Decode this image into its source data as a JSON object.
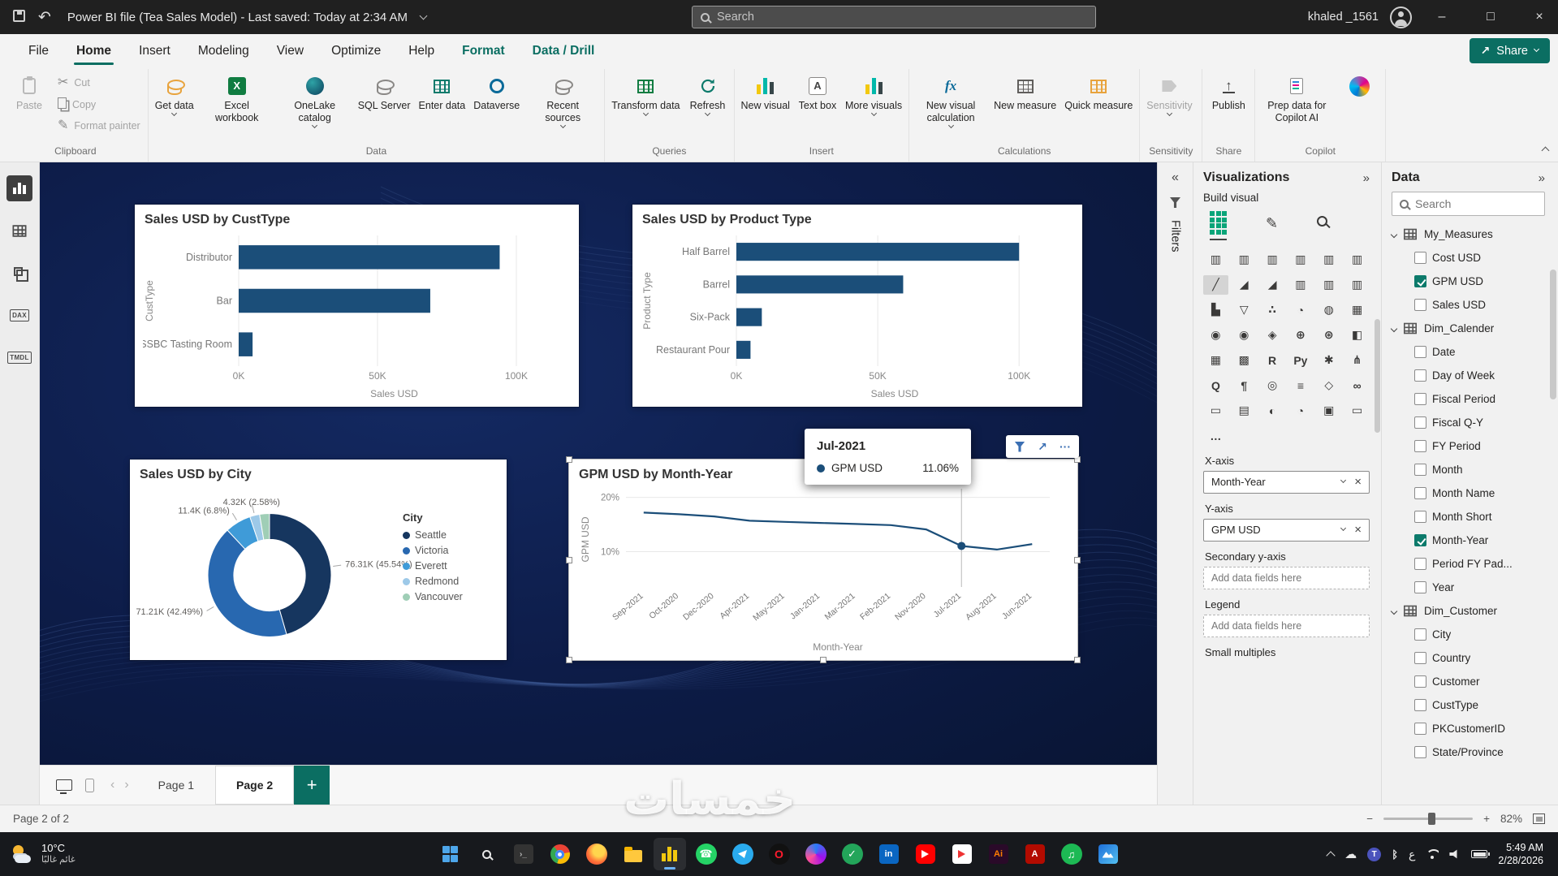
{
  "theme": {
    "accent_teal": "#0b6e62",
    "checkbox_teal": "#0c7a6b",
    "canvas_navy": "#0d1c48",
    "bar_blue": "#1b4e79"
  },
  "titlebar": {
    "title": "Power BI file (Tea Sales Model) - Last saved: Today at 2:34 AM",
    "search_placeholder": "Search",
    "user": "khaled _1561"
  },
  "menubar": {
    "tabs": [
      {
        "label": "File",
        "active": false,
        "contextual": false
      },
      {
        "label": "Home",
        "active": true,
        "contextual": false
      },
      {
        "label": "Insert",
        "active": false,
        "contextual": false
      },
      {
        "label": "Modeling",
        "active": false,
        "contextual": false
      },
      {
        "label": "View",
        "active": false,
        "contextual": false
      },
      {
        "label": "Optimize",
        "active": false,
        "contextual": false
      },
      {
        "label": "Help",
        "active": false,
        "contextual": false
      },
      {
        "label": "Format",
        "active": false,
        "contextual": true
      },
      {
        "label": "Data / Drill",
        "active": false,
        "contextual": true
      }
    ],
    "share_label": "Share"
  },
  "ribbon": {
    "groups": [
      {
        "label": "Clipboard",
        "items": [
          {
            "type": "big",
            "label": "Paste",
            "icon": "paste",
            "disabled": true
          },
          {
            "type": "col",
            "buttons": [
              {
                "label": "Cut",
                "icon": "cut",
                "disabled": true
              },
              {
                "label": "Copy",
                "icon": "copy",
                "disabled": true
              },
              {
                "label": "Format painter",
                "icon": "format-painter",
                "disabled": true
              }
            ]
          }
        ]
      },
      {
        "label": "Data",
        "items": [
          {
            "type": "big",
            "label": "Get data",
            "icon": "get-data",
            "chevron": true
          },
          {
            "type": "big",
            "label": "Excel workbook",
            "icon": "excel"
          },
          {
            "type": "big",
            "label": "OneLake catalog",
            "icon": "onelake",
            "chevron": true
          },
          {
            "type": "big",
            "label": "SQL Server",
            "icon": "sql-server"
          },
          {
            "type": "big",
            "label": "Enter data",
            "icon": "enter-data"
          },
          {
            "type": "big",
            "label": "Dataverse",
            "icon": "dataverse"
          },
          {
            "type": "big",
            "label": "Recent sources",
            "icon": "recent-sources",
            "chevron": true
          }
        ]
      },
      {
        "label": "Queries",
        "items": [
          {
            "type": "big",
            "label": "Transform data",
            "icon": "transform-data",
            "chevron": true
          },
          {
            "type": "big",
            "label": "Refresh",
            "icon": "refresh",
            "chevron": true
          }
        ]
      },
      {
        "label": "Insert",
        "items": [
          {
            "type": "big",
            "label": "New visual",
            "icon": "new-visual"
          },
          {
            "type": "big",
            "label": "Text box",
            "icon": "text-box"
          },
          {
            "type": "big",
            "label": "More visuals",
            "icon": "more-visuals",
            "chevron": true
          }
        ]
      },
      {
        "label": "Calculations",
        "items": [
          {
            "type": "big",
            "label": "New visual calculation",
            "icon": "new-visual-calculation",
            "chevron": true
          },
          {
            "type": "big",
            "label": "New measure",
            "icon": "new-measure"
          },
          {
            "type": "big",
            "label": "Quick measure",
            "icon": "quick-measure"
          }
        ]
      },
      {
        "label": "Sensitivity",
        "items": [
          {
            "type": "big",
            "label": "Sensitivity",
            "icon": "sensitivity",
            "chevron": true,
            "disabled": true
          }
        ]
      },
      {
        "label": "Share",
        "items": [
          {
            "type": "big",
            "label": "Publish",
            "icon": "publish"
          }
        ]
      },
      {
        "label": "Copilot",
        "items": [
          {
            "type": "big",
            "label": "Prep data for Copilot AI",
            "icon": "prep-copilot"
          },
          {
            "type": "big",
            "label": "",
            "icon": "copilot"
          }
        ]
      }
    ]
  },
  "leftrail": [
    "report-view",
    "table-view",
    "model-view",
    "dax-query-view",
    "tmdl-view"
  ],
  "chart_data": [
    {
      "type": "bar",
      "orientation": "horizontal",
      "title": "Sales USD by CustType",
      "categories": [
        "Distributor",
        "Bar",
        "SSBC Tasting Room"
      ],
      "values": [
        94000,
        69000,
        5000
      ],
      "xticks": [
        "0K",
        "50K",
        "100K"
      ],
      "xtick_values": [
        0,
        50000,
        100000
      ],
      "xmax": 112000,
      "xlabel": "Sales USD",
      "ylabel": "CustType",
      "bar_color": "#1b4e79",
      "grid": true
    },
    {
      "type": "bar",
      "orientation": "horizontal",
      "title": "Sales USD by Product Type",
      "categories": [
        "Half Barrel",
        "Barrel",
        "Six-Pack",
        "Restaurant Pour"
      ],
      "values": [
        100000,
        59000,
        9000,
        5000
      ],
      "xticks": [
        "0K",
        "50K",
        "100K"
      ],
      "xtick_values": [
        0,
        50000,
        100000
      ],
      "xmax": 112000,
      "xlabel": "Sales USD",
      "ylabel": "Product Type",
      "bar_color": "#1b4e79",
      "grid": true
    },
    {
      "type": "donut",
      "title": "Sales USD by City",
      "legend_title": "City",
      "legend_position": "right",
      "slices": [
        {
          "label": "Seattle",
          "value_k": 76.31,
          "pct": 45.54,
          "color": "#16365f",
          "data_label": "76.31K (45.54%)"
        },
        {
          "label": "Victoria",
          "value_k": 71.21,
          "pct": 42.49,
          "color": "#2868b0",
          "data_label": "71.21K (42.49%)"
        },
        {
          "label": "Everett",
          "value_k": 11.4,
          "pct": 6.8,
          "color": "#3f9bd8",
          "data_label": "11.4K (6.8%)"
        },
        {
          "label": "Redmond",
          "value_k": 4.32,
          "pct": 2.58,
          "color": "#9dc9e8",
          "data_label": "4.32K (2.58%)"
        },
        {
          "label": "Vancouver",
          "value_k": 4.34,
          "pct": 2.59,
          "color": "#9fceb6",
          "data_label": ""
        }
      ]
    },
    {
      "type": "line",
      "title": "GPM USD by Month-Year",
      "x": [
        "Sep-2021",
        "Oct-2020",
        "Dec-2020",
        "Apr-2021",
        "May-2021",
        "Jan-2021",
        "Mar-2021",
        "Feb-2021",
        "Nov-2020",
        "Jul-2021",
        "Aug-2021",
        "Jun-2021"
      ],
      "values": [
        17.2,
        16.9,
        16.5,
        15.7,
        15.5,
        15.3,
        15.1,
        14.9,
        14.1,
        11.06,
        10.4,
        11.4
      ],
      "ylim": [
        3.5,
        21
      ],
      "yticks": [
        "10%",
        "20%"
      ],
      "ytick_values": [
        10,
        20
      ],
      "xlabel": "Month-Year",
      "ylabel": "GPM USD",
      "line_color": "#1b4e79",
      "highlight_index": 9,
      "grid": true
    }
  ],
  "tooltip": {
    "title": "Jul-2021",
    "series": "GPM USD",
    "value": "11.06%",
    "dot_color": "#1b4e79"
  },
  "visual_header_icons": [
    "filter-icon",
    "focus-mode-icon",
    "more-options-icon"
  ],
  "filters_pane": {
    "label": "Filters"
  },
  "viz_panel": {
    "title": "Visualizations",
    "section": "Build visual",
    "subtabs": [
      "build-visual",
      "format-visual",
      "analytics"
    ],
    "visual_icons": [
      "stacked-bar-chart",
      "stacked-column-chart",
      "clustered-bar-chart",
      "clustered-column-chart",
      "100-stacked-bar-chart",
      "100-stacked-column-chart",
      "line-chart",
      "area-chart",
      "stacked-area-chart",
      "line-and-stacked-column-chart",
      "line-and-clustered-column-chart",
      "ribbon-chart",
      "waterfall-chart",
      "funnel-chart",
      "scatter-chart",
      "pie-chart",
      "donut-chart",
      "treemap",
      "map",
      "filled-map",
      "shape-map",
      "azure-map",
      "arcgis-map",
      "slicer",
      "table",
      "matrix",
      "r-script-visual",
      "python-visual",
      "key-influencers",
      "decomposition-tree",
      "qa-visual",
      "smart-narrative",
      "metrics",
      "paginated-report",
      "power-apps",
      "power-automate",
      "card",
      "multi-row-card",
      "kpi",
      "gauge",
      "button-slicer",
      "text-slicer",
      "more-options"
    ],
    "selected_visual": "line-chart",
    "field_wells": [
      {
        "label": "X-axis",
        "type": "pill",
        "value": "Month-Year"
      },
      {
        "label": "Y-axis",
        "type": "pill",
        "value": "GPM USD"
      },
      {
        "label": "Secondary y-axis",
        "type": "placeholder",
        "value": "Add data fields here"
      },
      {
        "label": "Legend",
        "type": "placeholder",
        "value": "Add data fields here"
      },
      {
        "label": "Small multiples",
        "type": "label-only"
      }
    ]
  },
  "data_panel": {
    "title": "Data",
    "search_placeholder": "Search",
    "tables": [
      {
        "name": "My_Measures",
        "icon": "measures-table-icon",
        "fields": [
          {
            "name": "Cost USD",
            "checked": false
          },
          {
            "name": "GPM USD",
            "checked": true
          },
          {
            "name": "Sales USD",
            "checked": false
          }
        ]
      },
      {
        "name": "Dim_Calender",
        "icon": "table-icon",
        "fields": [
          {
            "name": "Date",
            "checked": false,
            "icon": "date-field-icon"
          },
          {
            "name": "Day of Week",
            "checked": false
          },
          {
            "name": "Fiscal Period",
            "checked": false
          },
          {
            "name": "Fiscal Q-Y",
            "checked": false
          },
          {
            "name": "FY Period",
            "checked": false
          },
          {
            "name": "Month",
            "checked": false
          },
          {
            "name": "Month Name",
            "checked": false
          },
          {
            "name": "Month Short",
            "checked": false
          },
          {
            "name": "Month-Year",
            "checked": true
          },
          {
            "name": "Period FY Pad...",
            "checked": false
          },
          {
            "name": "Year",
            "checked": false
          }
        ]
      },
      {
        "name": "Dim_Customer",
        "icon": "table-icon",
        "fields": [
          {
            "name": "City",
            "checked": false
          },
          {
            "name": "Country",
            "checked": false
          },
          {
            "name": "Customer",
            "checked": false
          },
          {
            "name": "CustType",
            "checked": false
          },
          {
            "name": "PKCustomerID",
            "checked": false
          },
          {
            "name": "State/Province",
            "checked": false
          }
        ]
      }
    ]
  },
  "pagestrip": {
    "pages": [
      {
        "label": "Page 1",
        "active": false
      },
      {
        "label": "Page 2",
        "active": true
      }
    ]
  },
  "status": {
    "left": "Page 2 of 2",
    "zoom": "82%"
  },
  "taskbar": {
    "weather": {
      "temp": "10°C",
      "desc": "غائم غالبًا"
    },
    "apps": [
      "start",
      "search",
      "terminal",
      "chrome",
      "firefox",
      "file-explorer",
      "power-bi",
      "whatsapp",
      "telegram",
      "opera",
      "messenger",
      "security-check",
      "linkedin",
      "youtube",
      "media-player",
      "illustrator",
      "acrobat",
      "spotify",
      "photos"
    ],
    "active_app": "power-bi",
    "tray": [
      "chevron-up-icon",
      "onedrive-icon",
      "teams-icon",
      "bluetooth-icon",
      "language-indicator",
      "wifi-icon",
      "volume-icon",
      "battery-icon"
    ],
    "clock": {
      "time": "5:49 AM",
      "date": "2/28/2026"
    }
  },
  "watermark": {
    "text": "خمسات"
  }
}
